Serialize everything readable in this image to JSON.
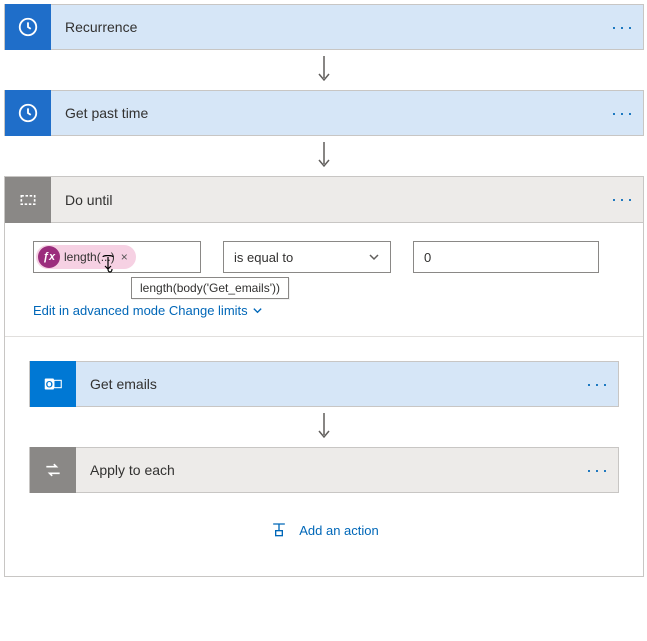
{
  "cards": {
    "recurrence": {
      "title": "Recurrence"
    },
    "get_past_time": {
      "title": "Get past time"
    },
    "do_until": {
      "title": "Do until"
    },
    "get_emails": {
      "title": "Get emails"
    },
    "apply_to_each": {
      "title": "Apply to each"
    }
  },
  "condition": {
    "token_label": "length(...)",
    "tooltip": "length(body('Get_emails'))",
    "operator": "is equal to",
    "value": "0"
  },
  "links": {
    "edit_advanced": "Edit in advanced mode",
    "change_limits": "Change limits",
    "add_action": "Add an action"
  }
}
